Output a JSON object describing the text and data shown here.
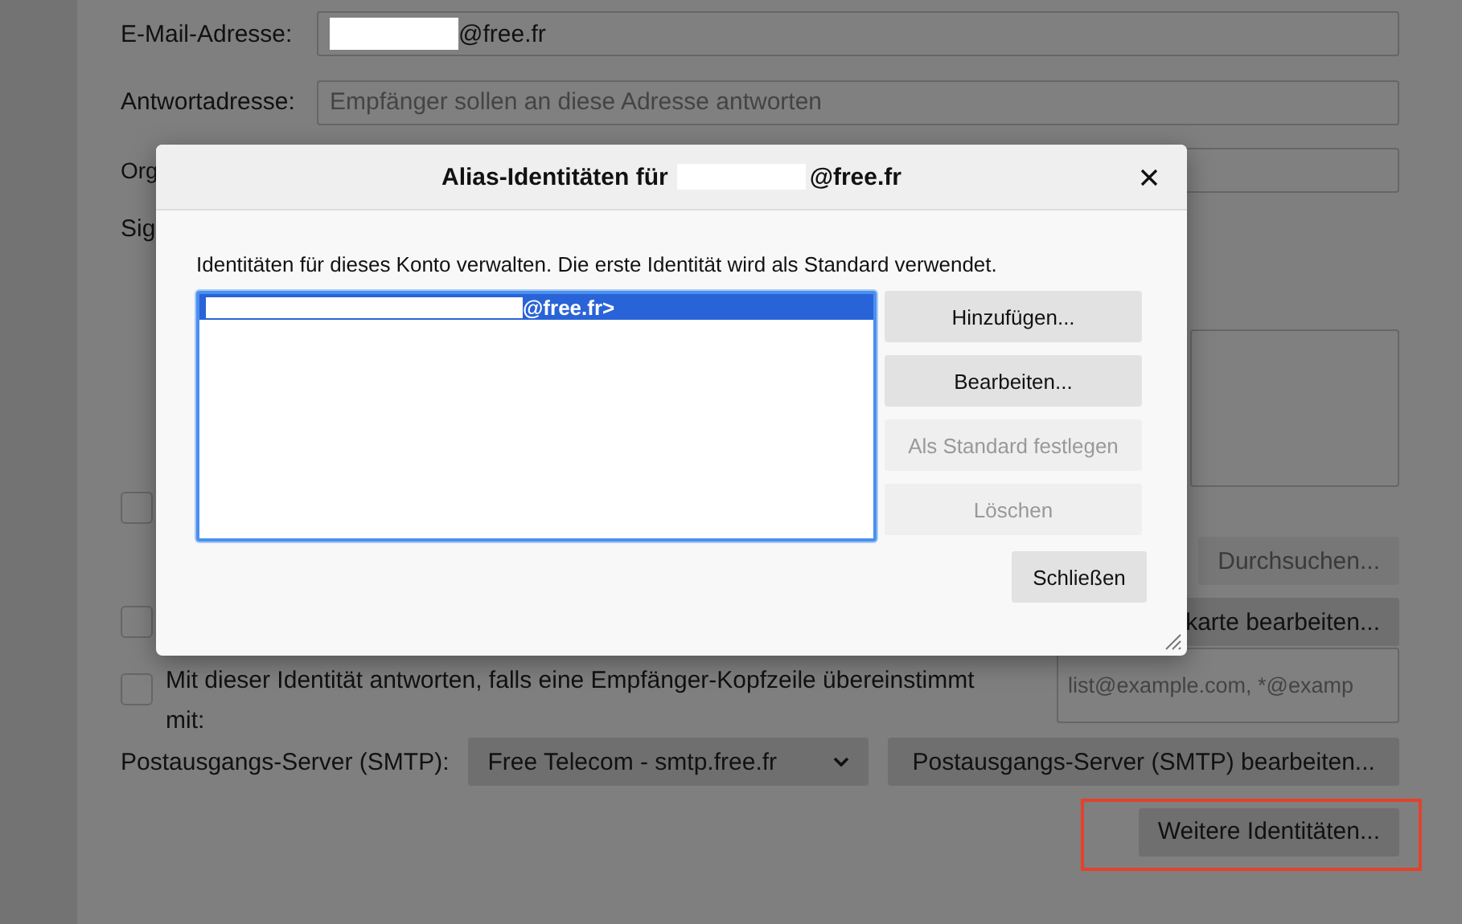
{
  "form": {
    "email": {
      "label": "E-Mail-Adresse:",
      "value": "@free.fr"
    },
    "reply_to": {
      "label": "Antwortadresse:",
      "placeholder": "Empfänger sollen an diese Adresse antworten"
    },
    "organization": {
      "label": "Org"
    },
    "signature": {
      "label": "Sig"
    },
    "checkboxes": [
      {
        "checked": false
      },
      {
        "checked": false
      },
      {
        "checked": false
      }
    ],
    "browse_button": {
      "label": "Durchsuchen...",
      "disabled": true
    },
    "vcard_button": {
      "label": "karte bearbeiten..."
    },
    "reply_match": {
      "label": "Mit dieser Identität antworten, falls eine Empfänger-Kopfzeile übereinstimmt",
      "label_2": "mit:",
      "placeholder": "list@example.com, *@examp"
    },
    "smtp": {
      "label": "Postausgangs-Server (SMTP):",
      "value": "Free Telecom - smtp.free.fr",
      "edit_button": "Postausgangs-Server (SMTP) bearbeiten..."
    },
    "more_identities": {
      "label": "Weitere Identitäten...",
      "highlighted": true
    }
  },
  "dialog": {
    "title": "Alias-Identitäten für",
    "title_suffix": "@free.fr",
    "description": "Identitäten für dieses Konto verwalten. Die erste Identität wird als Standard verwendet.",
    "identities": [
      {
        "text": "@free.fr>",
        "selected": true
      }
    ],
    "buttons": [
      {
        "label": "Hinzufügen...",
        "disabled": false
      },
      {
        "label": "Bearbeiten...",
        "disabled": false
      },
      {
        "label": "Als Standard festlegen",
        "disabled": true
      },
      {
        "label": "Löschen",
        "disabled": true
      }
    ],
    "close_button": "Schließen"
  }
}
